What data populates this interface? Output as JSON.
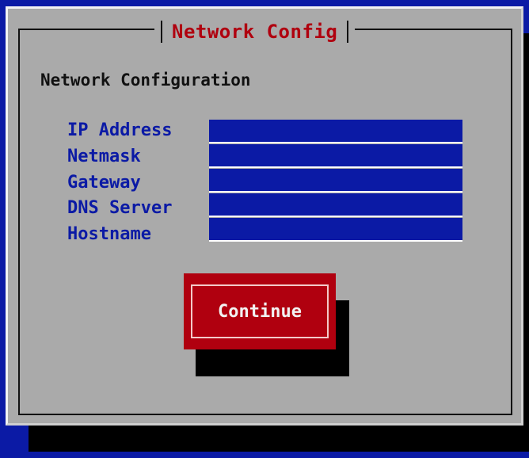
{
  "dialog": {
    "title": "Network Config",
    "heading": "Network Configuration"
  },
  "fields": [
    {
      "label": "IP Address",
      "value": ""
    },
    {
      "label": "Netmask",
      "value": ""
    },
    {
      "label": "Gateway",
      "value": ""
    },
    {
      "label": "DNS Server",
      "value": ""
    },
    {
      "label": "Hostname",
      "value": ""
    }
  ],
  "buttons": {
    "continue_label": "Continue"
  },
  "colors": {
    "background": "#0b1aa5",
    "dialog": "#aaaaaa",
    "title": "#b0000f",
    "field": "#0b1aa5",
    "button": "#b0000f"
  }
}
